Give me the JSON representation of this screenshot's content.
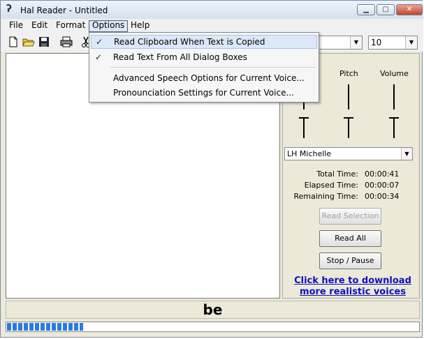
{
  "window": {
    "title": "Hal Reader - Untitled"
  },
  "menu": {
    "items": [
      "File",
      "Edit",
      "Format",
      "Options",
      "Help"
    ],
    "active": "Options"
  },
  "toolbar": {
    "font_size": "10"
  },
  "options_menu": {
    "items": [
      {
        "label": "Read Clipboard When Text is Copied",
        "checked": true
      },
      {
        "label": "Read Text From All Dialog Boxes",
        "checked": true
      },
      {
        "label": "Advanced Speech Options for Current Voice...",
        "checked": false
      },
      {
        "label": "Pronounciation Settings for Current Voice...",
        "checked": false
      }
    ],
    "check_mark": "✓"
  },
  "panel": {
    "pitch_label": "Pitch",
    "volume_label": "Volume",
    "voice": "LH Michelle",
    "total_time_label": "Total Time:",
    "total_time": "00:00:41",
    "elapsed_time_label": "Elapsed Time:",
    "elapsed_time": "00:00:07",
    "remaining_time_label": "Remaining Time:",
    "remaining_time": "00:00:34",
    "read_selection": "Read Selection",
    "read_all": "Read All",
    "stop_pause": "Stop / Pause",
    "link_line1": "Click here to download",
    "link_line2": "more realistic voices"
  },
  "status": {
    "current_word": "be",
    "progress_fraction": 0.185
  },
  "colors": {
    "link": "#1010c0",
    "progress": "#2a7ae2"
  }
}
